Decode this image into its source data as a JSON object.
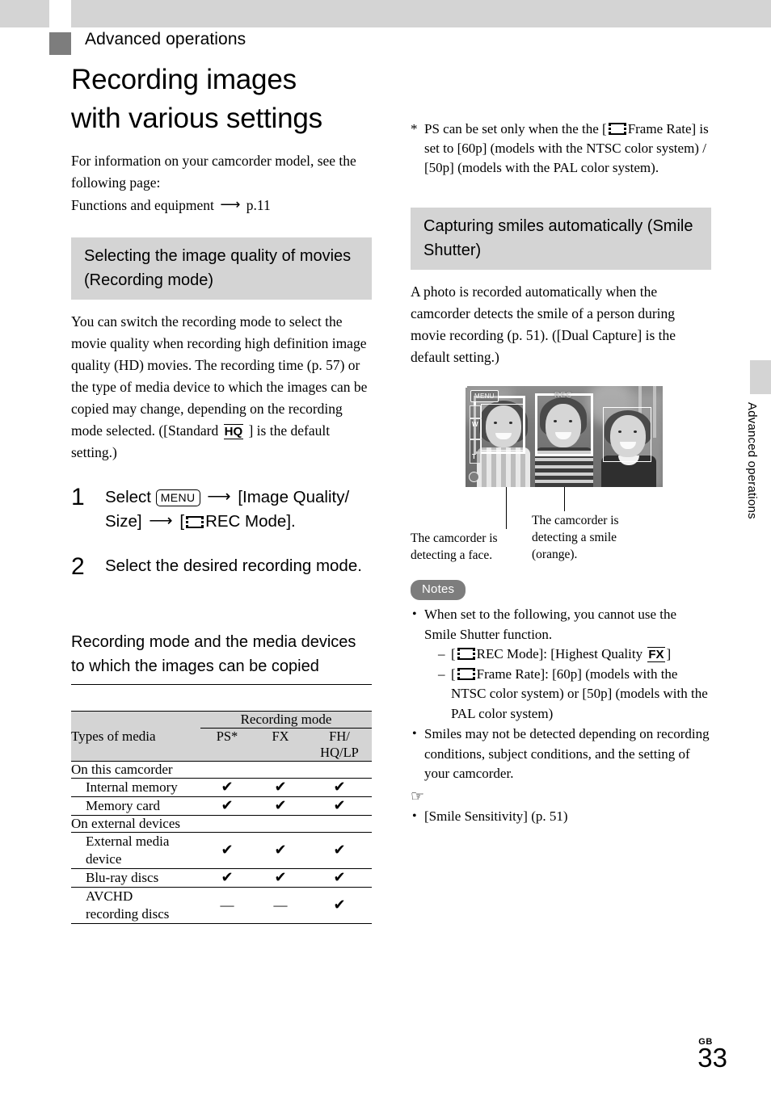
{
  "header": {
    "chapter": "Advanced operations",
    "page_title_line1": "Recording images",
    "page_title_line2": "with various settings"
  },
  "left_column": {
    "intro": "For information on your camcorder model, see the following page:",
    "intro_link_prefix": "Functions and equipment",
    "intro_link_page": "p.11",
    "section_heading": "Selecting the image quality of movies (Recording mode)",
    "section_body_a": "You can switch the recording mode to select the movie quality when recording high definition image quality (HD) movies. The recording time (p. 57) or the type of media device to which the images can be copied may change, depending on the recording mode selected. ([Standard",
    "hq_icon_label": "HQ",
    "section_body_b": "] is the default setting.)",
    "steps": [
      {
        "number": "1",
        "text_a": "Select",
        "menu_icon_label": "MENU",
        "text_b": "[Image Quality/ Size]",
        "text_c": "[",
        "text_d": "REC Mode]."
      },
      {
        "number": "2",
        "text": "Select the desired recording mode."
      }
    ],
    "sub_heading": "Recording mode and the media devices to which the images can be copied",
    "table": {
      "col_media_header": "Types of media",
      "group_header": "Recording mode",
      "mode_columns": [
        "PS*",
        "FX",
        "FH/ HQ/LP"
      ],
      "rows": [
        {
          "type": "group",
          "label": "On this camcorder",
          "marks": []
        },
        {
          "type": "item",
          "label": "Internal memory",
          "marks": [
            "check",
            "check",
            "check"
          ]
        },
        {
          "type": "item",
          "label": "Memory card",
          "marks": [
            "check",
            "check",
            "check"
          ]
        },
        {
          "type": "group",
          "label": "On external devices",
          "marks": []
        },
        {
          "type": "item",
          "label": "External media device",
          "marks": [
            "check",
            "check",
            "check"
          ]
        },
        {
          "type": "item",
          "label": "Blu-ray discs",
          "marks": [
            "check",
            "check",
            "check"
          ]
        },
        {
          "type": "item",
          "label": "AVCHD recording discs",
          "marks": [
            "dash",
            "dash",
            "check"
          ]
        }
      ],
      "check_glyph": "✔",
      "dash_glyph": "—"
    }
  },
  "right_column": {
    "footnote_marker": "*",
    "footnote_a": "PS can be set only when the the [",
    "footnote_b": "Frame Rate] is set to [60p] (models with the NTSC color system) / [50p] (models with the PAL color system).",
    "section_heading": "Capturing smiles automatically (Smile Shutter)",
    "section_body": "A photo is recorded automatically when the camcorder detects the smile of a person during movie recording (p. 51). ([Dual Capture] is the default setting.)",
    "figure": {
      "osd_menu": "MENU",
      "osd_rec": "REC",
      "zoom_wide": "W",
      "zoom_tele": "T",
      "caption_face": "The camcorder is detecting a face.",
      "caption_smile": "The camcorder is detecting a smile (orange)."
    },
    "notes_badge": "Notes",
    "notes": [
      {
        "text": "When set to the following, you cannot use the Smile Shutter function.",
        "sub": [
          {
            "pre": "[",
            "post": "REC Mode]: [Highest Quality",
            "icon_box": "FX",
            "tail": "]"
          },
          {
            "pre": "[",
            "post": "Frame Rate]: [60p] (models with the NTSC color system) or [50p] (models with the PAL color system)",
            "icon_box": "",
            "tail": ""
          }
        ]
      },
      {
        "text": "Smiles may not be detected depending on recording conditions, subject conditions, and the setting of your camcorder.",
        "sub": []
      }
    ],
    "hand_icon": "☞",
    "see_also": "[Smile Sensitivity] (p. 51)"
  },
  "side_tab": "Advanced operations",
  "page_footer": {
    "region": "GB",
    "number": "33"
  },
  "colors": {
    "band_gray": "#d4d4d4",
    "swatch_gray": "#7d7d7d",
    "text_black": "#000000"
  }
}
